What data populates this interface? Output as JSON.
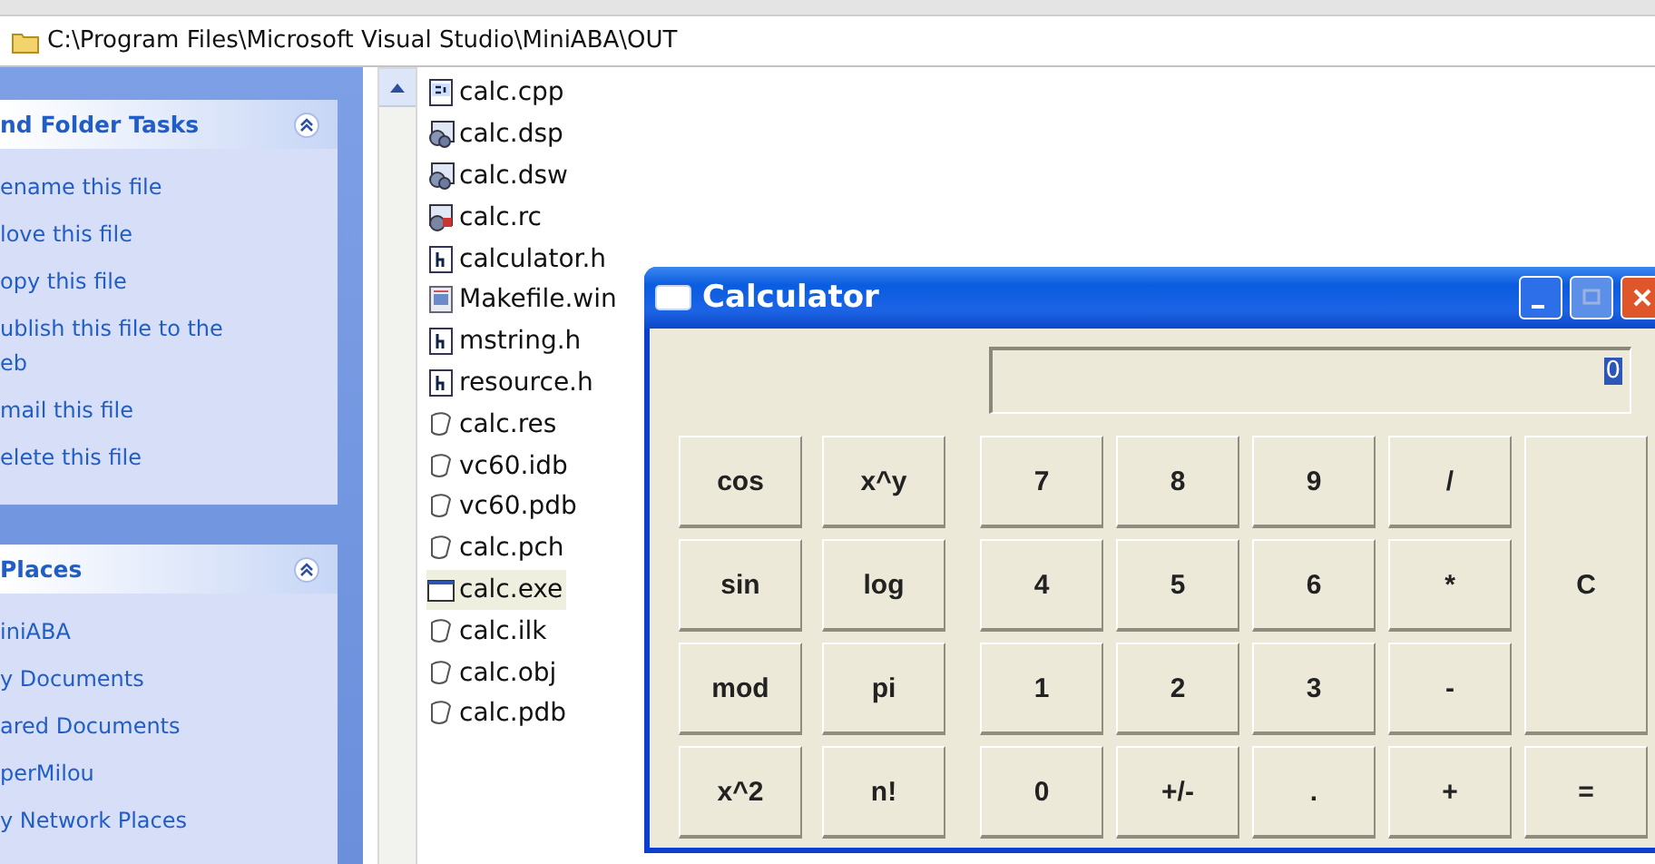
{
  "address_bar": {
    "path": "C:\\Program Files\\Microsoft Visual Studio\\MiniABA\\OUT"
  },
  "task_panels": [
    {
      "title": "nd Folder Tasks",
      "expanded": true,
      "items": [
        "ename this file",
        "love this file",
        "opy this file",
        "ublish this file to the\neb",
        "mail this file",
        "elete this file"
      ]
    },
    {
      "title": "Places",
      "expanded": true,
      "items": [
        "iniABA",
        "y Documents",
        "ared Documents",
        "perMilou",
        "y Network Places"
      ]
    }
  ],
  "files": [
    {
      "name": "calc.cpp",
      "kind": "cpp",
      "selected": false
    },
    {
      "name": "calc.dsp",
      "kind": "project",
      "selected": false
    },
    {
      "name": "calc.dsw",
      "kind": "project",
      "selected": false
    },
    {
      "name": "calc.rc",
      "kind": "resource",
      "selected": false
    },
    {
      "name": "calculator.h",
      "kind": "header",
      "selected": false
    },
    {
      "name": "Makefile.win",
      "kind": "makefile",
      "selected": false
    },
    {
      "name": "mstring.h",
      "kind": "header",
      "selected": false
    },
    {
      "name": "resource.h",
      "kind": "header",
      "selected": false
    },
    {
      "name": "calc.res",
      "kind": "generic",
      "selected": false
    },
    {
      "name": "vc60.idb",
      "kind": "generic",
      "selected": false
    },
    {
      "name": "vc60.pdb",
      "kind": "generic",
      "selected": false
    },
    {
      "name": "calc.pch",
      "kind": "generic",
      "selected": false
    },
    {
      "name": "calc.exe",
      "kind": "exe",
      "selected": true
    },
    {
      "name": "calc.ilk",
      "kind": "generic",
      "selected": false
    },
    {
      "name": "calc.obj",
      "kind": "generic",
      "selected": false
    },
    {
      "name": "calc.pdb",
      "kind": "generic",
      "selected": false
    }
  ],
  "calculator": {
    "title": "Calculator",
    "display": "0",
    "functions": [
      "cos",
      "x^y",
      "sin",
      "log",
      "mod",
      "pi",
      "x^2",
      "n!"
    ],
    "keys": [
      {
        "label": "7",
        "kind": "normal"
      },
      {
        "label": "8",
        "kind": "normal"
      },
      {
        "label": "9",
        "kind": "normal"
      },
      {
        "label": "/",
        "kind": "normal"
      },
      {
        "label": "4",
        "kind": "normal"
      },
      {
        "label": "5",
        "kind": "normal"
      },
      {
        "label": "6",
        "kind": "normal"
      },
      {
        "label": "*",
        "kind": "normal"
      },
      {
        "label": "C",
        "kind": "tall"
      },
      {
        "label": "1",
        "kind": "normal"
      },
      {
        "label": "2",
        "kind": "normal"
      },
      {
        "label": "3",
        "kind": "normal"
      },
      {
        "label": "-",
        "kind": "normal"
      },
      {
        "label": "0",
        "kind": "normal"
      },
      {
        "label": "+/-",
        "kind": "normal"
      },
      {
        "label": ".",
        "kind": "normal"
      },
      {
        "label": "+",
        "kind": "normal"
      },
      {
        "label": "=",
        "kind": "normal"
      }
    ]
  }
}
